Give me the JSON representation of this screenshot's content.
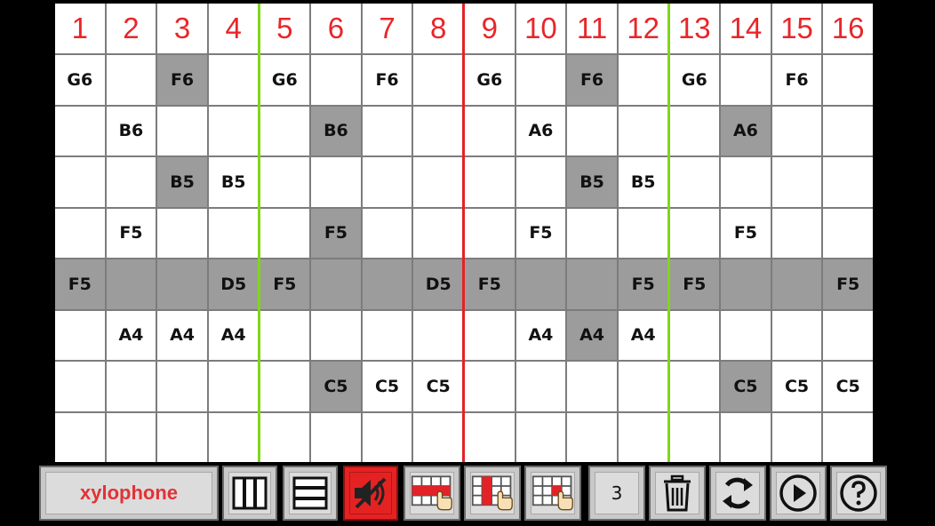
{
  "columns": [
    "1",
    "2",
    "3",
    "4",
    "5",
    "6",
    "7",
    "8",
    "9",
    "10",
    "11",
    "12",
    "13",
    "14",
    "15",
    "16"
  ],
  "rows": [
    {
      "band": false,
      "cells": [
        {
          "n": "G6",
          "s": false
        },
        {
          "n": "",
          "s": false
        },
        {
          "n": "F6",
          "s": true
        },
        {
          "n": "",
          "s": false
        },
        {
          "n": "G6",
          "s": false
        },
        {
          "n": "",
          "s": false
        },
        {
          "n": "F6",
          "s": false
        },
        {
          "n": "",
          "s": false
        },
        {
          "n": "G6",
          "s": false
        },
        {
          "n": "",
          "s": false
        },
        {
          "n": "F6",
          "s": true
        },
        {
          "n": "",
          "s": false
        },
        {
          "n": "G6",
          "s": false
        },
        {
          "n": "",
          "s": false
        },
        {
          "n": "F6",
          "s": false
        },
        {
          "n": "",
          "s": false
        }
      ]
    },
    {
      "band": false,
      "cells": [
        {
          "n": "",
          "s": false
        },
        {
          "n": "B6",
          "s": false
        },
        {
          "n": "",
          "s": false
        },
        {
          "n": "",
          "s": false
        },
        {
          "n": "",
          "s": false
        },
        {
          "n": "B6",
          "s": true
        },
        {
          "n": "",
          "s": false
        },
        {
          "n": "",
          "s": false
        },
        {
          "n": "",
          "s": false
        },
        {
          "n": "A6",
          "s": false
        },
        {
          "n": "",
          "s": false
        },
        {
          "n": "",
          "s": false
        },
        {
          "n": "",
          "s": false
        },
        {
          "n": "A6",
          "s": true
        },
        {
          "n": "",
          "s": false
        },
        {
          "n": "",
          "s": false
        }
      ]
    },
    {
      "band": false,
      "cells": [
        {
          "n": "",
          "s": false
        },
        {
          "n": "",
          "s": false
        },
        {
          "n": "B5",
          "s": true
        },
        {
          "n": "B5",
          "s": false
        },
        {
          "n": "",
          "s": false
        },
        {
          "n": "",
          "s": false
        },
        {
          "n": "",
          "s": false
        },
        {
          "n": "",
          "s": false
        },
        {
          "n": "",
          "s": false
        },
        {
          "n": "",
          "s": false
        },
        {
          "n": "B5",
          "s": true
        },
        {
          "n": "B5",
          "s": false
        },
        {
          "n": "",
          "s": false
        },
        {
          "n": "",
          "s": false
        },
        {
          "n": "",
          "s": false
        },
        {
          "n": "",
          "s": false
        }
      ]
    },
    {
      "band": false,
      "cells": [
        {
          "n": "",
          "s": false
        },
        {
          "n": "F5",
          "s": false
        },
        {
          "n": "",
          "s": false
        },
        {
          "n": "",
          "s": false
        },
        {
          "n": "",
          "s": false
        },
        {
          "n": "F5",
          "s": true
        },
        {
          "n": "",
          "s": false
        },
        {
          "n": "",
          "s": false
        },
        {
          "n": "",
          "s": false
        },
        {
          "n": "F5",
          "s": false
        },
        {
          "n": "",
          "s": false
        },
        {
          "n": "",
          "s": false
        },
        {
          "n": "",
          "s": false
        },
        {
          "n": "F5",
          "s": false
        },
        {
          "n": "",
          "s": false
        },
        {
          "n": "",
          "s": false
        }
      ]
    },
    {
      "band": true,
      "cells": [
        {
          "n": "F5",
          "s": true
        },
        {
          "n": "",
          "s": true
        },
        {
          "n": "",
          "s": true
        },
        {
          "n": "D5",
          "s": true
        },
        {
          "n": "F5",
          "s": true
        },
        {
          "n": "",
          "s": true
        },
        {
          "n": "",
          "s": true
        },
        {
          "n": "D5",
          "s": true
        },
        {
          "n": "F5",
          "s": true
        },
        {
          "n": "",
          "s": true
        },
        {
          "n": "",
          "s": true
        },
        {
          "n": "F5",
          "s": true
        },
        {
          "n": "F5",
          "s": true
        },
        {
          "n": "",
          "s": true
        },
        {
          "n": "",
          "s": true
        },
        {
          "n": "F5",
          "s": true
        }
      ]
    },
    {
      "band": false,
      "cells": [
        {
          "n": "",
          "s": false
        },
        {
          "n": "A4",
          "s": false
        },
        {
          "n": "A4",
          "s": false
        },
        {
          "n": "A4",
          "s": false
        },
        {
          "n": "",
          "s": false
        },
        {
          "n": "",
          "s": false
        },
        {
          "n": "",
          "s": false
        },
        {
          "n": "",
          "s": false
        },
        {
          "n": "",
          "s": false
        },
        {
          "n": "A4",
          "s": false
        },
        {
          "n": "A4",
          "s": true
        },
        {
          "n": "A4",
          "s": false
        },
        {
          "n": "",
          "s": false
        },
        {
          "n": "",
          "s": false
        },
        {
          "n": "",
          "s": false
        },
        {
          "n": "",
          "s": false
        }
      ]
    },
    {
      "band": false,
      "cells": [
        {
          "n": "",
          "s": false
        },
        {
          "n": "",
          "s": false
        },
        {
          "n": "",
          "s": false
        },
        {
          "n": "",
          "s": false
        },
        {
          "n": "",
          "s": false
        },
        {
          "n": "C5",
          "s": true
        },
        {
          "n": "C5",
          "s": false
        },
        {
          "n": "C5",
          "s": false
        },
        {
          "n": "",
          "s": false
        },
        {
          "n": "",
          "s": false
        },
        {
          "n": "",
          "s": false
        },
        {
          "n": "",
          "s": false
        },
        {
          "n": "",
          "s": false
        },
        {
          "n": "C5",
          "s": true
        },
        {
          "n": "C5",
          "s": false
        },
        {
          "n": "C5",
          "s": false
        }
      ]
    },
    {
      "band": false,
      "cells": [
        {
          "n": "",
          "s": false
        },
        {
          "n": "",
          "s": false
        },
        {
          "n": "",
          "s": false
        },
        {
          "n": "",
          "s": false
        },
        {
          "n": "",
          "s": false
        },
        {
          "n": "",
          "s": false
        },
        {
          "n": "",
          "s": false
        },
        {
          "n": "",
          "s": false
        },
        {
          "n": "",
          "s": false
        },
        {
          "n": "",
          "s": false
        },
        {
          "n": "",
          "s": false
        },
        {
          "n": "",
          "s": false
        },
        {
          "n": "",
          "s": false
        },
        {
          "n": "",
          "s": false
        },
        {
          "n": "",
          "s": false
        },
        {
          "n": "",
          "s": false
        }
      ]
    }
  ],
  "toolbar": {
    "instrument_label": "xylophone",
    "page_count": "3",
    "buttons": [
      "column-layout-icon",
      "row-layout-icon",
      "mute-icon",
      "pattern-1-icon",
      "pattern-2-icon",
      "pattern-3-icon",
      "trash-icon",
      "refresh-icon",
      "play-icon",
      "help-icon"
    ]
  },
  "colors": {
    "header_text": "#e8262a",
    "beat_line": "#7fd61a",
    "bar_line": "#e32228",
    "selected_cell": "#9c9c9c",
    "mute_active": "#e52222"
  }
}
